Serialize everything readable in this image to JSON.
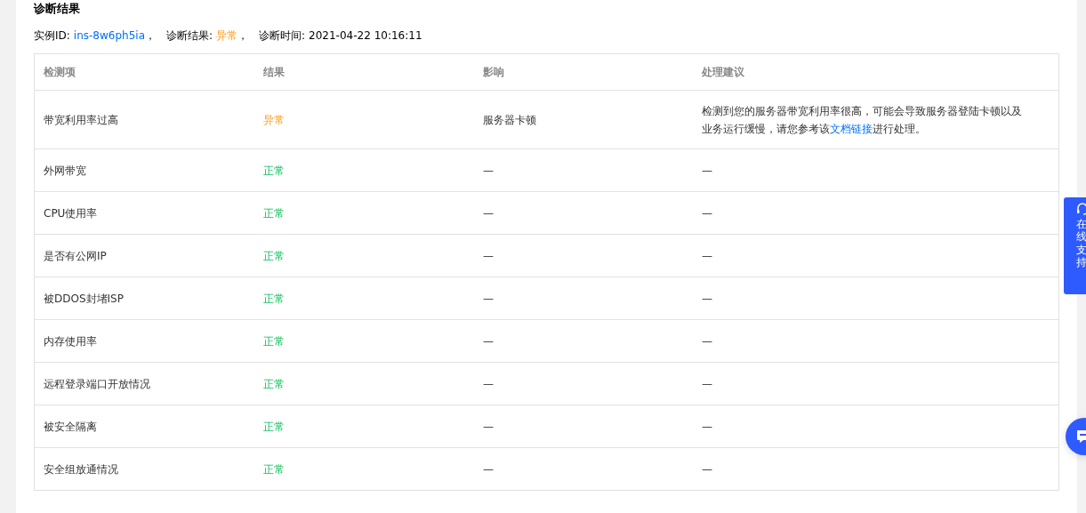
{
  "heading": "诊断结果",
  "summary": [
    {
      "label": "实例ID:",
      "value": "ins-8w6ph5ia",
      "kind": "link",
      "suffix": "，"
    },
    {
      "label": "诊断结果:",
      "value": "异常",
      "kind": "status",
      "abnormal": true,
      "suffix": "，"
    },
    {
      "label": "诊断时间:",
      "value": "2021-04-22 10:16:11",
      "kind": "plain"
    }
  ],
  "table": {
    "columns": [
      "检测项",
      "结果",
      "影响",
      "处理建议"
    ],
    "rows": [
      {
        "item": "带宽利用率过高",
        "result": "异常",
        "abnormal": true,
        "impact": "服务器卡顿",
        "advice": {
          "text": "检测到您的服务器带宽利用率很高，可能会导致服务器登陆卡顿以及业务运行缓慢，请您参考该",
          "link": "文档链接",
          "after": "进行处理。"
        }
      },
      {
        "item": "外网带宽",
        "result": "正常",
        "abnormal": false,
        "impact": "—",
        "advice": {
          "text": "—"
        }
      },
      {
        "item": "CPU使用率",
        "result": "正常",
        "abnormal": false,
        "impact": "—",
        "advice": {
          "text": "—"
        }
      },
      {
        "item": "是否有公网IP",
        "result": "正常",
        "abnormal": false,
        "impact": "—",
        "advice": {
          "text": "—"
        }
      },
      {
        "item": "被DDOS封堵ISP",
        "result": "正常",
        "abnormal": false,
        "impact": "—",
        "advice": {
          "text": "—"
        }
      },
      {
        "item": "内存使用率",
        "result": "正常",
        "abnormal": false,
        "impact": "—",
        "advice": {
          "text": "—"
        }
      },
      {
        "item": "远程登录端口开放情况",
        "result": "正常",
        "abnormal": false,
        "impact": "—",
        "advice": {
          "text": "—"
        }
      },
      {
        "item": "被安全隔离",
        "result": "正常",
        "abnormal": false,
        "impact": "—",
        "advice": {
          "text": "—"
        }
      },
      {
        "item": "安全组放通情况",
        "result": "正常",
        "abnormal": false,
        "impact": "—",
        "advice": {
          "text": "—"
        }
      }
    ]
  },
  "support_button": {
    "label": "在线支持"
  }
}
